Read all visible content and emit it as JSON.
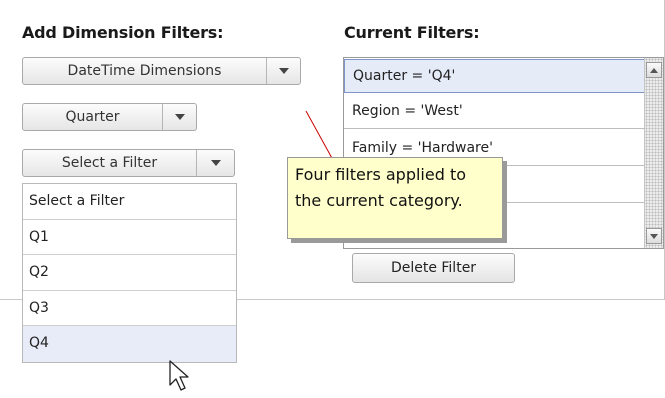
{
  "left_heading": "Add Dimension Filters:",
  "right_heading": "Current Filters:",
  "dimension_combo": {
    "label": "DateTime Dimensions"
  },
  "quarter_combo": {
    "label": "Quarter"
  },
  "filter_combo": {
    "label": "Select a Filter"
  },
  "dropdown_items": [
    "Select a Filter",
    "Q1",
    "Q2",
    "Q3",
    "Q4"
  ],
  "dropdown_selected": "Q4",
  "current_filters": [
    "Quarter  = 'Q4'",
    "Region  = 'West'",
    "Family  = 'Hardware'",
    "",
    ""
  ],
  "delete_button": "Delete Filter",
  "callout": {
    "line1": "Four filters applied to",
    "line2": "the current category."
  },
  "colors": {
    "callout_bg": "#ffffcc",
    "selected_row": "#e6ebf8",
    "callout_line": "#cc0000"
  },
  "icons": {
    "combo_arrow": "chevron-down-icon",
    "scroll_up": "scroll-up-icon",
    "scroll_down": "scroll-down-icon",
    "cursor": "mouse-pointer-icon"
  }
}
